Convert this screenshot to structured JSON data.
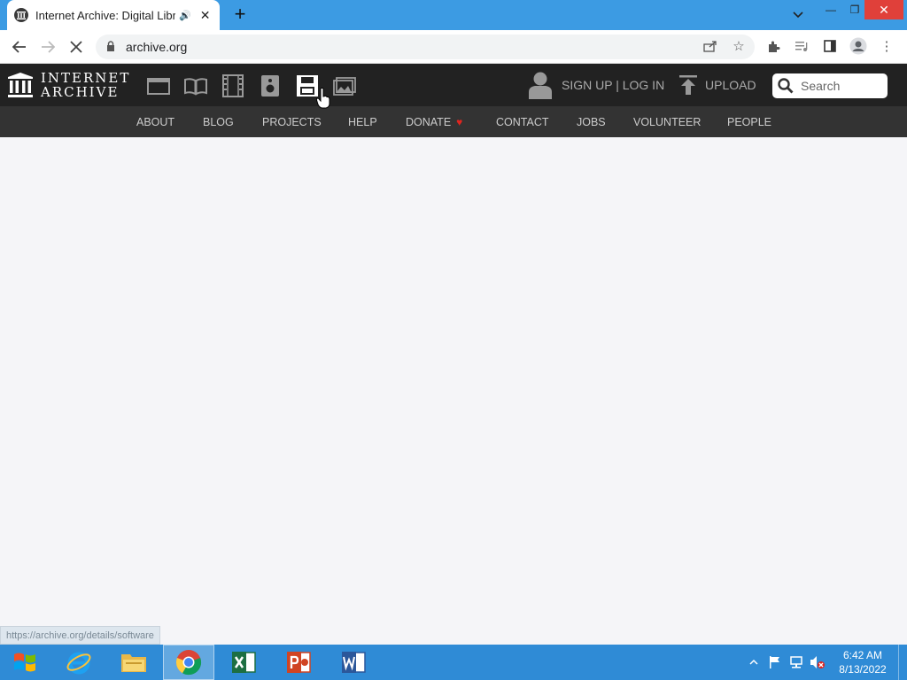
{
  "browser": {
    "tab": {
      "title": "Internet Archive: Digital Libra",
      "favicon": "internet-archive-icon",
      "audio_icon": "speaker-icon",
      "close_label": "✕"
    },
    "new_tab_label": "+",
    "window_controls": {
      "minimize": "—",
      "maximize": "❐",
      "close": "✕"
    },
    "address": {
      "url": "archive.org",
      "lock_icon": "lock-icon"
    }
  },
  "ia": {
    "logo": {
      "line1": "INTERNET",
      "line2": "ARCHIVE"
    },
    "media_icons": [
      "web-icon",
      "texts-icon",
      "video-icon",
      "audio-icon",
      "software-icon",
      "images-icon"
    ],
    "account_label": "SIGN UP | LOG IN",
    "upload_label": "UPLOAD",
    "search": {
      "placeholder": "Search"
    },
    "subnav": [
      "ABOUT",
      "BLOG",
      "PROJECTS",
      "HELP",
      "DONATE",
      "CONTACT",
      "JOBS",
      "VOLUNTEER",
      "PEOPLE"
    ]
  },
  "status_bar": {
    "text": "https://archive.org/details/software"
  },
  "taskbar": {
    "apps": [
      "start-button",
      "internet-explorer-icon",
      "file-explorer-icon",
      "chrome-icon",
      "excel-icon",
      "powerpoint-icon",
      "word-icon"
    ],
    "clock": {
      "time": "6:42 AM",
      "date": "8/13/2022"
    }
  },
  "colors": {
    "chrome_top": "#3c9be3",
    "ia_header": "#222222",
    "ia_subnav": "#333333",
    "taskbar": "#2f8bd6",
    "donate_heart": "#e0251f"
  }
}
